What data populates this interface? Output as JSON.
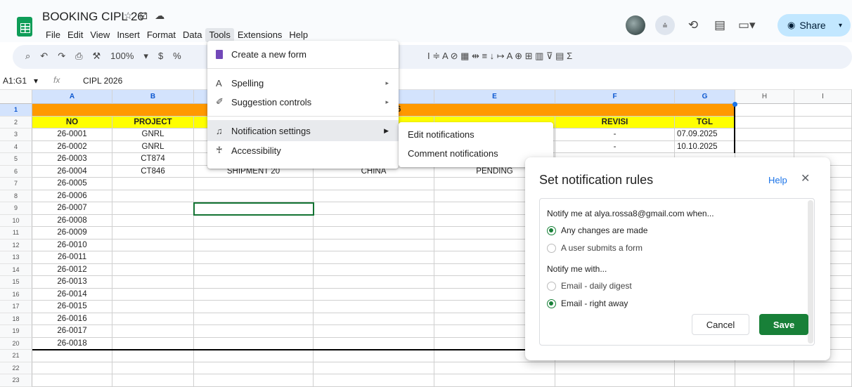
{
  "app": {
    "doc_title": "BOOKING CIPL 26'",
    "menu": [
      "File",
      "Edit",
      "View",
      "Insert",
      "Format",
      "Data",
      "Tools",
      "Extensions",
      "Help"
    ],
    "active_menu": "Tools",
    "share_label": "Share"
  },
  "toolbar": {
    "zoom": "100%",
    "currency": "$",
    "percent": "%",
    "right_glyphs": "I ≑ A ⊘ ▦ ⇹ ≡ ↓ ↦ A ⊕ ⊞ ▥ ⊽ ▤ Σ"
  },
  "formula_bar": {
    "name_box": "A1:G1",
    "fx": "fx",
    "value": "CIPL 2026"
  },
  "columns": [
    "A",
    "B",
    "C",
    "D",
    "E",
    "F",
    "G",
    "H",
    "I"
  ],
  "rows": [
    "1",
    "2",
    "3",
    "4",
    "5",
    "6",
    "7",
    "8",
    "9",
    "10",
    "11",
    "12",
    "13",
    "14",
    "15",
    "16",
    "17",
    "18",
    "19",
    "20",
    "21",
    "22",
    "23"
  ],
  "sheet": {
    "band_fragment": "6",
    "headers": {
      "a": "NO",
      "b": "PROJECT",
      "f": "REVISI",
      "g": "TGL"
    },
    "data_rows": [
      {
        "a": "26-0001",
        "b": "GNRL",
        "c": "",
        "e": "",
        "f": "-",
        "g": "07.09.2025"
      },
      {
        "a": "26-0002",
        "b": "GNRL",
        "c": "",
        "e": "",
        "f": "-",
        "g": "10.10.2025"
      },
      {
        "a": "26-0003",
        "b": "CT874",
        "c": "",
        "e": "",
        "f": "",
        "g": ""
      },
      {
        "a": "26-0004",
        "b": "CT846",
        "c": "SHIPMENT 20",
        "d": "CHINA",
        "e": "PENDING",
        "f": "",
        "g": ""
      },
      {
        "a": "26-0005"
      },
      {
        "a": "26-0006"
      },
      {
        "a": "26-0007"
      },
      {
        "a": "26-0008"
      },
      {
        "a": "26-0009"
      },
      {
        "a": "26-0010"
      },
      {
        "a": "26-0011"
      },
      {
        "a": "26-0012"
      },
      {
        "a": "26-0013"
      },
      {
        "a": "26-0014"
      },
      {
        "a": "26-0015"
      },
      {
        "a": "26-0016"
      },
      {
        "a": "26-0017"
      },
      {
        "a": "26-0018"
      }
    ]
  },
  "tools_menu": {
    "create_form": "Create a new form",
    "spelling": "Spelling",
    "suggestion_controls": "Suggestion controls",
    "notification_settings": "Notification settings",
    "accessibility": "Accessibility"
  },
  "notification_submenu": {
    "edit": "Edit notifications",
    "comment": "Comment notifications"
  },
  "dialog": {
    "title": "Set notification rules",
    "help": "Help",
    "close": "✕",
    "notify_when_label": "Notify me at alya.rossa8@gmail.com when...",
    "opt_any_changes": "Any changes are made",
    "opt_form_submit": "A user submits a form",
    "notify_with_label": "Notify me with...",
    "opt_daily": "Email - daily digest",
    "opt_right_away": "Email - right away",
    "cancel": "Cancel",
    "save": "Save",
    "selected_when": "any_changes",
    "selected_with": "right_away"
  },
  "colors": {
    "header_band": "#ff9900",
    "header_yellow": "#ffff00",
    "accent_green": "#188038",
    "share_bg": "#c2e7ff"
  }
}
